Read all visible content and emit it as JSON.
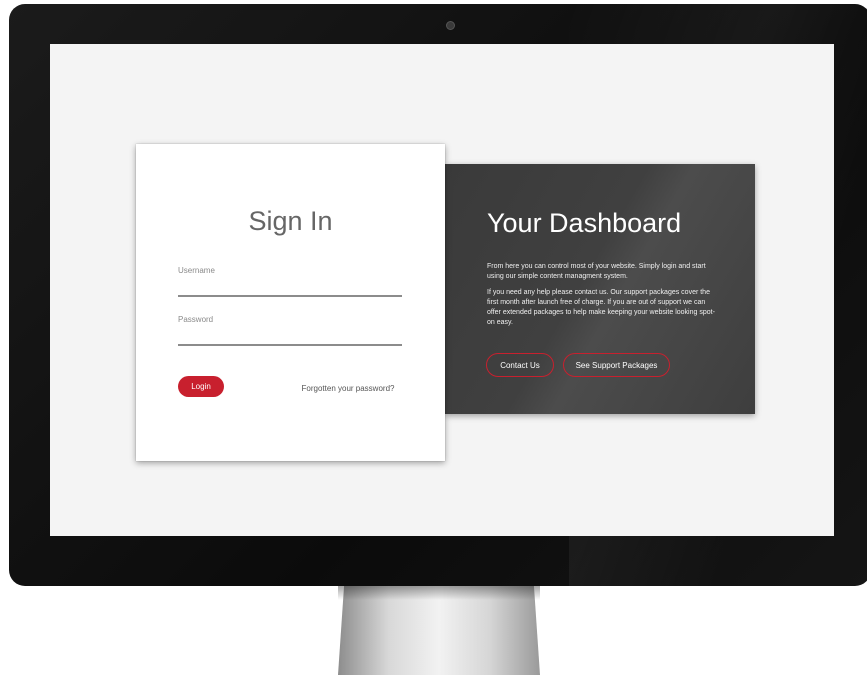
{
  "signin": {
    "title": "Sign In",
    "username_label": "Username",
    "password_label": "Password",
    "login_button": "Login",
    "forgot_link": "Forgotten your password?"
  },
  "dashboard": {
    "title": "Your Dashboard",
    "paragraph1": "From here you can control most of your website. Simply login and start using our simple content managment system.",
    "paragraph2": "If you need any help please contact us. Our support packages cover the first month after launch free of charge. If you are out of support we can offer extended packages to help make keeping your website looking spot-on easy.",
    "contact_button": "Contact Us",
    "support_button": "See Support Packages"
  },
  "colors": {
    "accent": "#c8202e",
    "panel": "#404040",
    "screen_bg": "#f4f4f4"
  }
}
